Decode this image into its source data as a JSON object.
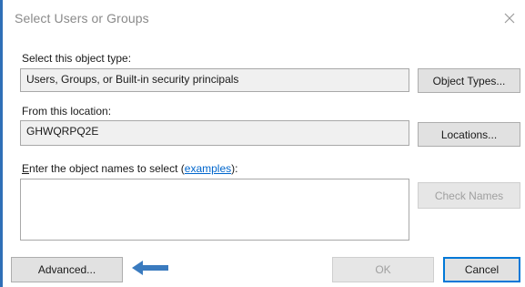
{
  "window": {
    "title": "Select Users or Groups",
    "close_icon": "close-icon",
    "accent_color": "#2f6fb7"
  },
  "object_type": {
    "label": "Select this object type:",
    "value": "Users, Groups, or Built-in security principals",
    "button_label": "Object Types..."
  },
  "location": {
    "label": "From this location:",
    "value": "GHWQRPQ2E",
    "button_label": "Locations..."
  },
  "object_names": {
    "label_prefix": "E",
    "label_rest": "nter the object names to select (",
    "link_text": "examples",
    "label_suffix": "):",
    "value": "",
    "check_names_label": "Check Names"
  },
  "footer": {
    "advanced_label": "Advanced...",
    "arrow_icon": "arrow-left-icon",
    "arrow_color": "#3a7bbf",
    "ok_label": "OK",
    "cancel_label": "Cancel"
  }
}
